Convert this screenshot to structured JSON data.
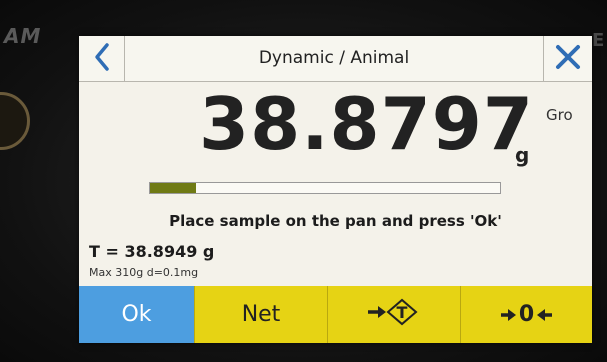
{
  "bezel": {
    "left_text": "AM",
    "right_text": "E"
  },
  "header": {
    "title": "Dynamic / Animal",
    "back_icon": "chevron-left-icon",
    "close_icon": "close-icon"
  },
  "reading": {
    "value": "38.8797",
    "unit": "g",
    "mode": "Gro",
    "progress": 0.13
  },
  "prompt": "Place sample on the pan and press 'Ok'",
  "tare": "T = 38.8949 g",
  "specs": "Max 310g   d=0.1mg",
  "buttons": {
    "ok": "Ok",
    "net": "Net",
    "tare_icon": "tare-icon",
    "zero_label": "0",
    "zero_icon": "zero-icon"
  },
  "colors": {
    "ok_button": "#4d9ee0",
    "function_buttons": "#e6d314",
    "progress_fill": "#6f7a14",
    "accent_blue": "#2f6db5"
  }
}
